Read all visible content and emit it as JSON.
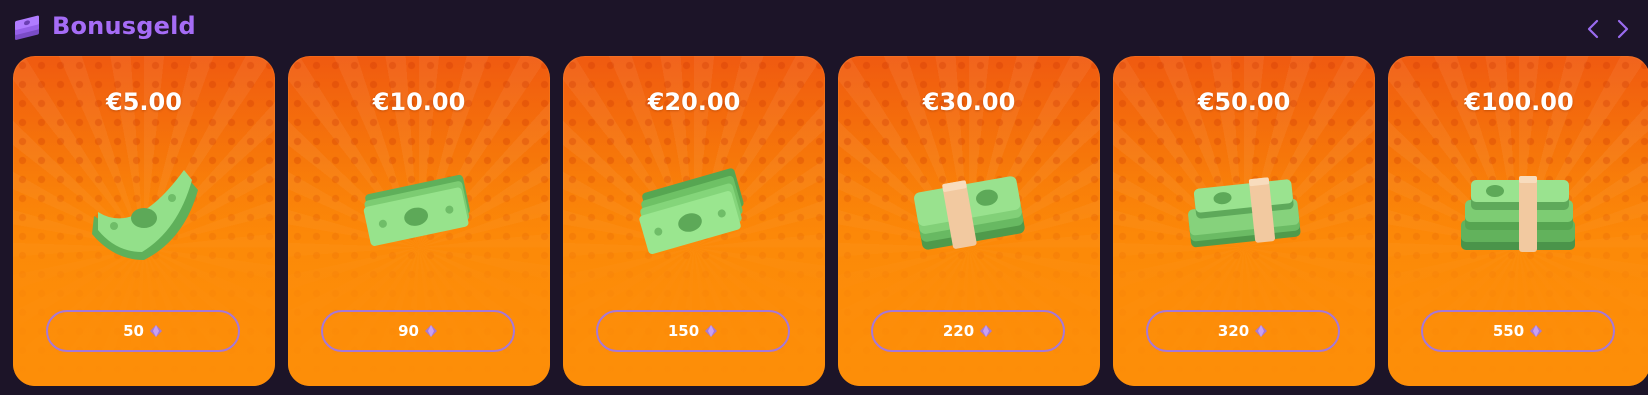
{
  "header": {
    "title": "Bonusgeld",
    "icon": "money-stack-icon",
    "accent_color": "#a56cf6"
  },
  "navigation": {
    "prev_icon": "chevron-left-icon",
    "next_icon": "chevron-right-icon"
  },
  "cards": [
    {
      "amount": "€5.00",
      "price": "50",
      "illustration": "single-bill"
    },
    {
      "amount": "€10.00",
      "price": "90",
      "illustration": "two-bills"
    },
    {
      "amount": "€20.00",
      "price": "150",
      "illustration": "three-bills"
    },
    {
      "amount": "€30.00",
      "price": "220",
      "illustration": "banded-bundle"
    },
    {
      "amount": "€50.00",
      "price": "320",
      "illustration": "two-bundles"
    },
    {
      "amount": "€100.00",
      "price": "550",
      "illustration": "bundle-pile"
    }
  ],
  "currency_icon": "gem-icon",
  "colors": {
    "card_orange": "#fb8708",
    "price_border": "#a678d8",
    "background": "#1c1428"
  }
}
